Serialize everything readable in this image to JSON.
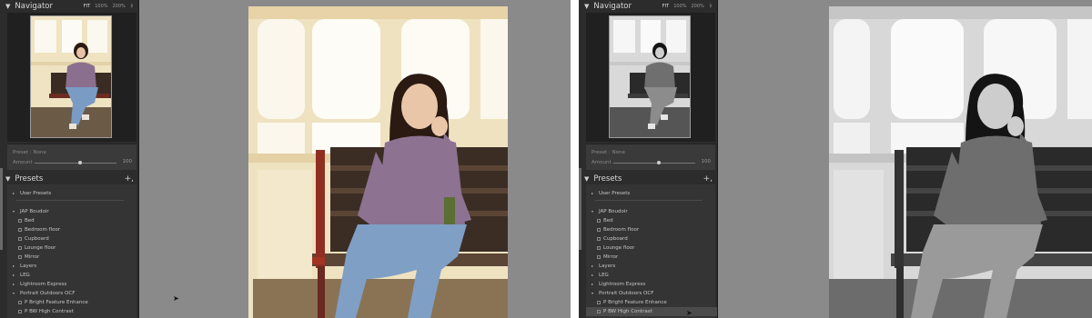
{
  "navigator": {
    "title": "Navigator",
    "zoom": {
      "fit": "FIT",
      "z1": "100%",
      "z2": "200%",
      "more": "⇕"
    }
  },
  "preset_controls": {
    "preset_line": "Preset : None",
    "amount_label": "Amount",
    "amount_value": "100"
  },
  "presets_panel": {
    "title": "Presets",
    "add": "+,",
    "items": [
      {
        "label": "User Presets",
        "level": 0,
        "arrow": "▸"
      },
      {
        "label": "JAP Boudoir",
        "level": 0,
        "arrow": "▾"
      },
      {
        "label": "Bed",
        "level": 1
      },
      {
        "label": "Bedroom floor",
        "level": 1
      },
      {
        "label": "Cupboard",
        "level": 1
      },
      {
        "label": "Lounge floor",
        "level": 1
      },
      {
        "label": "Mirror",
        "level": 1
      },
      {
        "label": "Layers",
        "level": 0,
        "arrow": "▸"
      },
      {
        "label": "LEG",
        "level": 0,
        "arrow": "▸"
      },
      {
        "label": "Lightroom Express",
        "level": 0,
        "arrow": "▸"
      },
      {
        "label": "Portrait Outdoors OCF",
        "level": 0,
        "arrow": "▾"
      },
      {
        "label": "P Bright Feature Enhance",
        "level": 1
      },
      {
        "label": "P BW High Contrast",
        "level": 1
      }
    ]
  },
  "colors": {
    "panel_bg": "#2c2c2c",
    "canvas_bg": "#8a8a8a",
    "list_bg": "#343434",
    "hover_row": "#4b4b4b"
  },
  "icons": {
    "collapse": "triangle-down-icon",
    "expand": "triangle-right-icon",
    "preset": "preset-icon",
    "cursor": "mouse-pointer-icon"
  }
}
